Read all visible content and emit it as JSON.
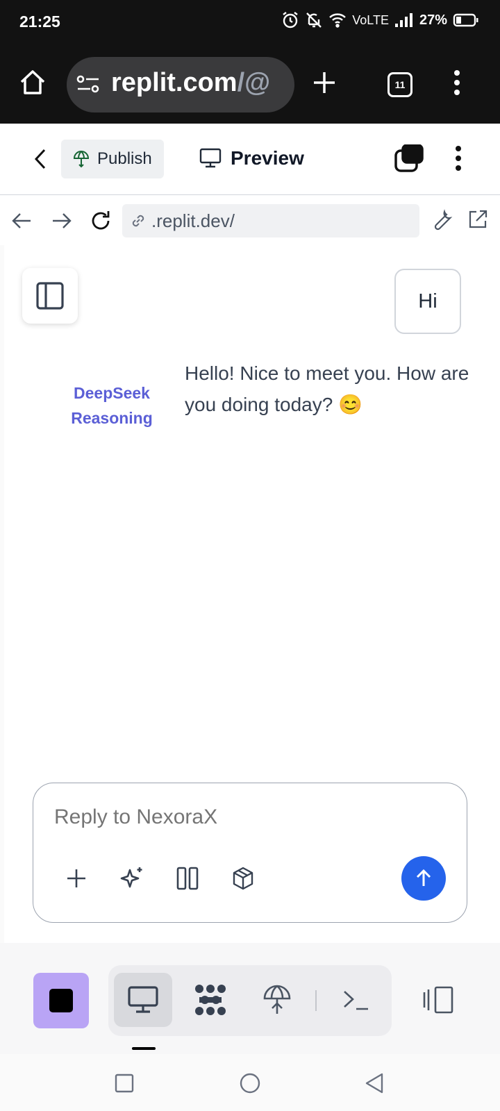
{
  "status_bar": {
    "time": "21:25",
    "network": "VoLTE",
    "battery": "27%"
  },
  "browser": {
    "url_host": "replit.com",
    "url_path": "/@",
    "tab_count": "11"
  },
  "replit_header": {
    "publish_label": "Publish",
    "preview_label": "Preview"
  },
  "webview": {
    "address": ".replit.dev/"
  },
  "chat": {
    "user_message": "Hi",
    "model_label": "DeepSeek Reasoning",
    "assistant_message": "Hello! Nice to meet you. How are you doing today? 😊"
  },
  "composer": {
    "placeholder": "Reply to NexoraX"
  },
  "colors": {
    "accent_blue": "#2563eb",
    "model_label": "#5b5fd6",
    "stop_button": "#b9a4f5"
  },
  "icons": {
    "browser": [
      "home-icon",
      "site-settings-icon",
      "new-tab-plus-icon",
      "tab-switcher-icon",
      "overflow-menu-icon"
    ],
    "header": [
      "back-chevron-icon",
      "publish-globe-icon",
      "monitor-icon",
      "window-stack-icon",
      "kebab-menu-icon"
    ],
    "webview": [
      "nav-back-icon",
      "nav-forward-icon",
      "reload-icon",
      "link-icon",
      "wrench-icon",
      "external-link-icon"
    ],
    "composer": [
      "plus-icon",
      "sparkle-icon",
      "columns-icon",
      "cube-icon",
      "arrow-up-icon"
    ],
    "bottom": [
      "stop-icon",
      "monitor-icon",
      "agent-icon",
      "deploy-icon",
      "terminal-icon",
      "panel-switch-icon"
    ],
    "system": [
      "recents-icon",
      "home-circle-icon",
      "back-triangle-icon"
    ]
  }
}
